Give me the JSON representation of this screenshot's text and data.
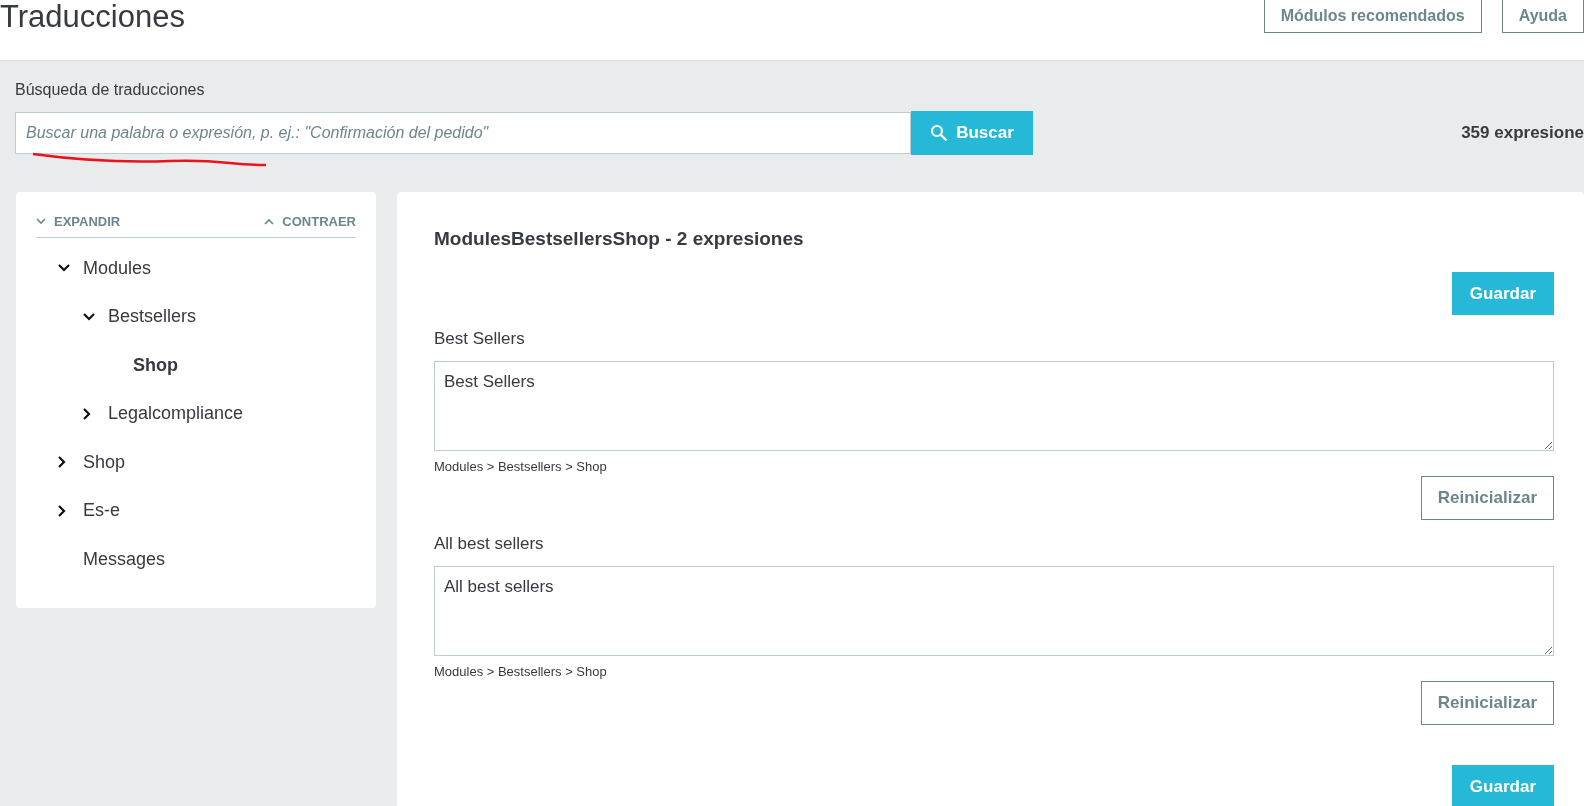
{
  "header": {
    "title": "Traducciones",
    "buttons": [
      "Módulos recomendados",
      "Ayuda"
    ]
  },
  "search": {
    "label": "Búsqueda de traducciones",
    "placeholder": "Buscar una palabra o expresión, p. ej.: \"Confirmación del pedido\"",
    "button": "Buscar",
    "count": "359 expresione"
  },
  "tree": {
    "expand": "EXPANDIR",
    "collapse": "CONTRAER",
    "items": [
      {
        "label": "Modules",
        "expanded": true,
        "selected": false,
        "children": [
          {
            "label": "Bestsellers",
            "expanded": true,
            "selected": false,
            "children": [
              {
                "label": "Shop",
                "selected": true
              }
            ]
          },
          {
            "label": "Legalcompliance",
            "expanded": false,
            "selected": false
          }
        ]
      },
      {
        "label": "Shop",
        "expanded": false,
        "selected": false
      },
      {
        "label": "Es-e",
        "expanded": false,
        "selected": false
      },
      {
        "label": "Messages",
        "selected": false
      }
    ]
  },
  "panel": {
    "title": "ModulesBestsellersShop - 2 expresiones",
    "save": "Guardar",
    "entries": [
      {
        "label": "Best Sellers",
        "value": "Best Sellers",
        "path": "Modules > Bestsellers > Shop",
        "reset": "Reinicializar"
      },
      {
        "label": "All best sellers",
        "value": "All best sellers",
        "path": "Modules > Bestsellers > Shop",
        "reset": "Reinicializar"
      }
    ],
    "save_bottom": "Guardar"
  }
}
